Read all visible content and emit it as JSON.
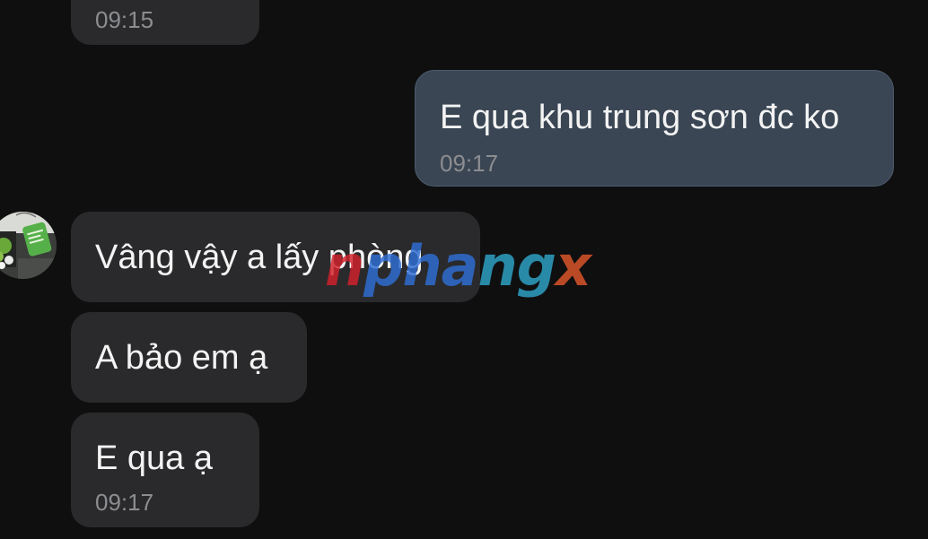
{
  "messages": [
    {
      "id": "m1",
      "direction": "incoming",
      "text": "",
      "time": "09:15"
    },
    {
      "id": "m2",
      "direction": "outgoing",
      "text": "E qua khu trung sơn đc ko",
      "time": "09:17"
    },
    {
      "id": "m3",
      "direction": "incoming",
      "text": "Vâng vậy a lấy phòng",
      "time": ""
    },
    {
      "id": "m4",
      "direction": "incoming",
      "text": "A bảo em ạ",
      "time": ""
    },
    {
      "id": "m5",
      "direction": "incoming",
      "text": "E qua ạ",
      "time": "09:17"
    }
  ],
  "avatar": {
    "icon": "contact-avatar"
  },
  "watermark": {
    "part1": "n",
    "part2": "pha",
    "part3": "ng",
    "part4": "x"
  },
  "colors": {
    "background": "#0f0f10",
    "incoming_bubble": "#2a2a2c",
    "outgoing_bubble": "#3a4654",
    "timestamp": "#8c8d90"
  }
}
